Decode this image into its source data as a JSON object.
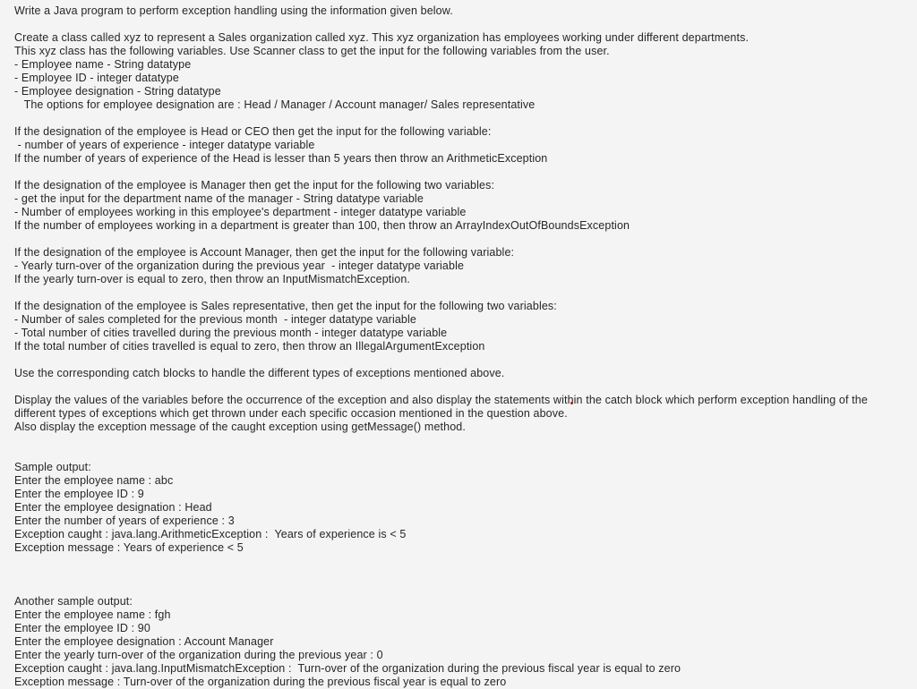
{
  "document": {
    "background_color": "#f4f4f4",
    "text_color": "#262626",
    "marker_color": "#cc1111",
    "title_line": "Write a Java program to perform exception handling using the information given below.",
    "blocks": [
      {
        "name": "intro",
        "lines": [
          "Write a Java program to perform exception handling using the information given below."
        ]
      },
      {
        "name": "class-description",
        "lines": [
          "Create a class called xyz to represent a Sales organization called xyz. This xyz organization has employees working under different departments.",
          "This xyz class has the following variables. Use Scanner class to get the input for the following variables from the user.",
          "- Employee name - String datatype",
          "- Employee ID - integer datatype",
          "- Employee designation - String datatype",
          "   The options for employee designation are : Head / Manager / Account manager/ Sales representative"
        ]
      },
      {
        "name": "head-rule",
        "lines": [
          "If the designation of the employee is Head or CEO then get the input for the following variable:",
          " - number of years of experience - integer datatype variable",
          "If the number of years of experience of the Head is lesser than 5 years then throw an ArithmeticException"
        ]
      },
      {
        "name": "manager-rule",
        "lines": [
          "If the designation of the employee is Manager then get the input for the following two variables:",
          "- get the input for the department name of the manager - String datatype variable",
          "- Number of employees working in this employee's department - integer datatype variable",
          "If the number of employees working in a department is greater than 100, then throw an ArrayIndexOutOfBoundsException"
        ]
      },
      {
        "name": "account-manager-rule",
        "lines": [
          "If the designation of the employee is Account Manager, then get the input for the following variable:",
          "- Yearly turn-over of the organization during the previous year  - integer datatype variable",
          "If the yearly turn-over is equal to zero, then throw an InputMismatchException."
        ]
      },
      {
        "name": "sales-representative-rule",
        "lines": [
          "If the designation of the employee is Sales representative, then get the input for the following two variables:",
          "- Number of sales completed for the previous month  - integer datatype variable",
          "- Total number of cities travelled during the previous month - integer datatype variable",
          "If the total number of cities travelled is equal to zero, then throw an IllegalArgumentException"
        ]
      },
      {
        "name": "catch-blocks-instruction",
        "lines": [
          "Use the corresponding catch blocks to handle the different types of exceptions mentioned above."
        ]
      },
      {
        "name": "display-instruction",
        "lines": [
          "Display the values of the variables before the occurrence of the exception and also display the statements within the catch block which perform exception handling of the",
          "different types of exceptions which get thrown under each specific occasion mentioned in the question above.",
          "Also display the exception message of the caught exception using getMessage() method."
        ]
      },
      {
        "name": "sample-output-one",
        "lines": [
          "Sample output:",
          "Enter the employee name : abc",
          "Enter the employee ID : 9",
          "Enter the employee designation : Head",
          "Enter the number of years of experience : 3",
          "Exception caught : java.lang.ArithmeticException :  Years of experience is < 5",
          "Exception message : Years of experience < 5"
        ]
      },
      {
        "name": "sample-output-two",
        "lines": [
          "Another sample output:",
          "Enter the employee name : fgh",
          "Enter the employee ID : 90",
          "Enter the employee designation : Account Manager",
          "Enter the yearly turn-over of the organization during the previous year : 0",
          "Exception caught : java.lang.InputMismatchException :  Turn-over of the organization during the previous fiscal year is equal to zero",
          "Exception message : Turn-over of the organization during the previous fiscal year is equal to zero"
        ]
      }
    ],
    "block_gaps": [
      1,
      1,
      1,
      1,
      1,
      1,
      1,
      1,
      2,
      3
    ]
  }
}
